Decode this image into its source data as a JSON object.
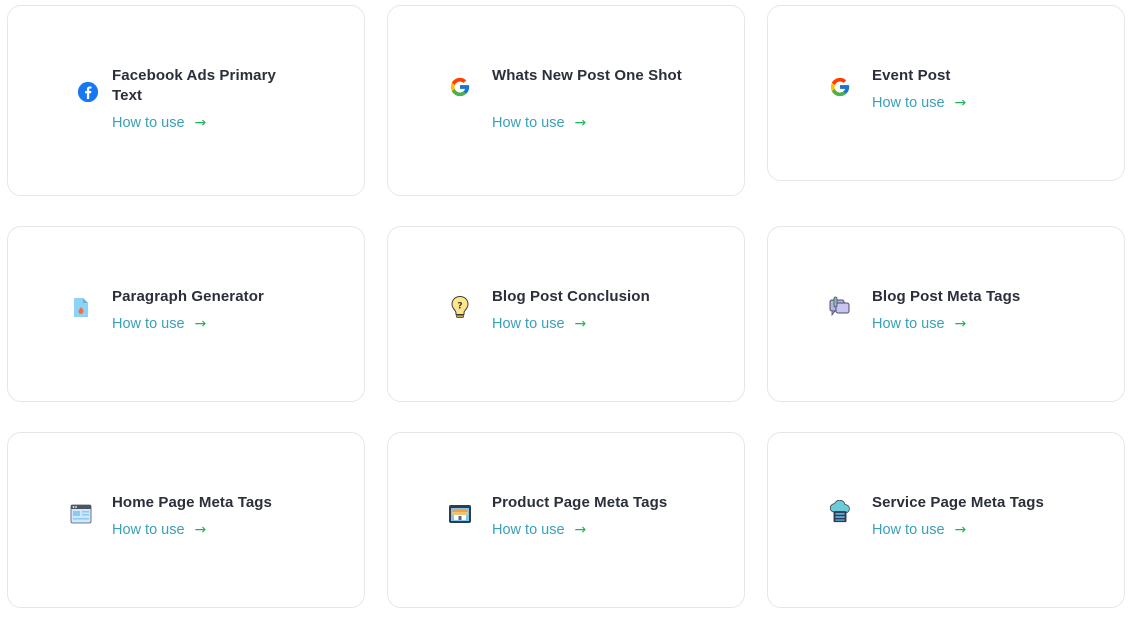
{
  "cards": [
    {
      "title": "Facebook Ads Primary Text",
      "link": "How to use",
      "icon": "facebook-icon"
    },
    {
      "title": "Whats New Post One Shot",
      "link": "How to use",
      "icon": "google-icon"
    },
    {
      "title": "Event Post",
      "link": "How to use",
      "icon": "google-icon"
    },
    {
      "title": "Paragraph Generator",
      "link": "How to use",
      "icon": "paragraph-document-icon"
    },
    {
      "title": "Blog Post Conclusion",
      "link": "How to use",
      "icon": "question-bulb-icon"
    },
    {
      "title": "Blog Post Meta Tags",
      "link": "How to use",
      "icon": "meta-tag-chat-icon"
    },
    {
      "title": "Home Page Meta Tags",
      "link": "How to use",
      "icon": "browser-window-icon"
    },
    {
      "title": "Product Page Meta Tags",
      "link": "How to use",
      "icon": "storefront-icon"
    },
    {
      "title": "Service Page Meta Tags",
      "link": "How to use",
      "icon": "cloud-server-icon"
    }
  ],
  "colors": {
    "link": "#3aa0b8",
    "arrow": "#22b35a",
    "title": "#2a2f3b",
    "border": "#e5e7eb",
    "facebook_blue": "#1877f2"
  }
}
